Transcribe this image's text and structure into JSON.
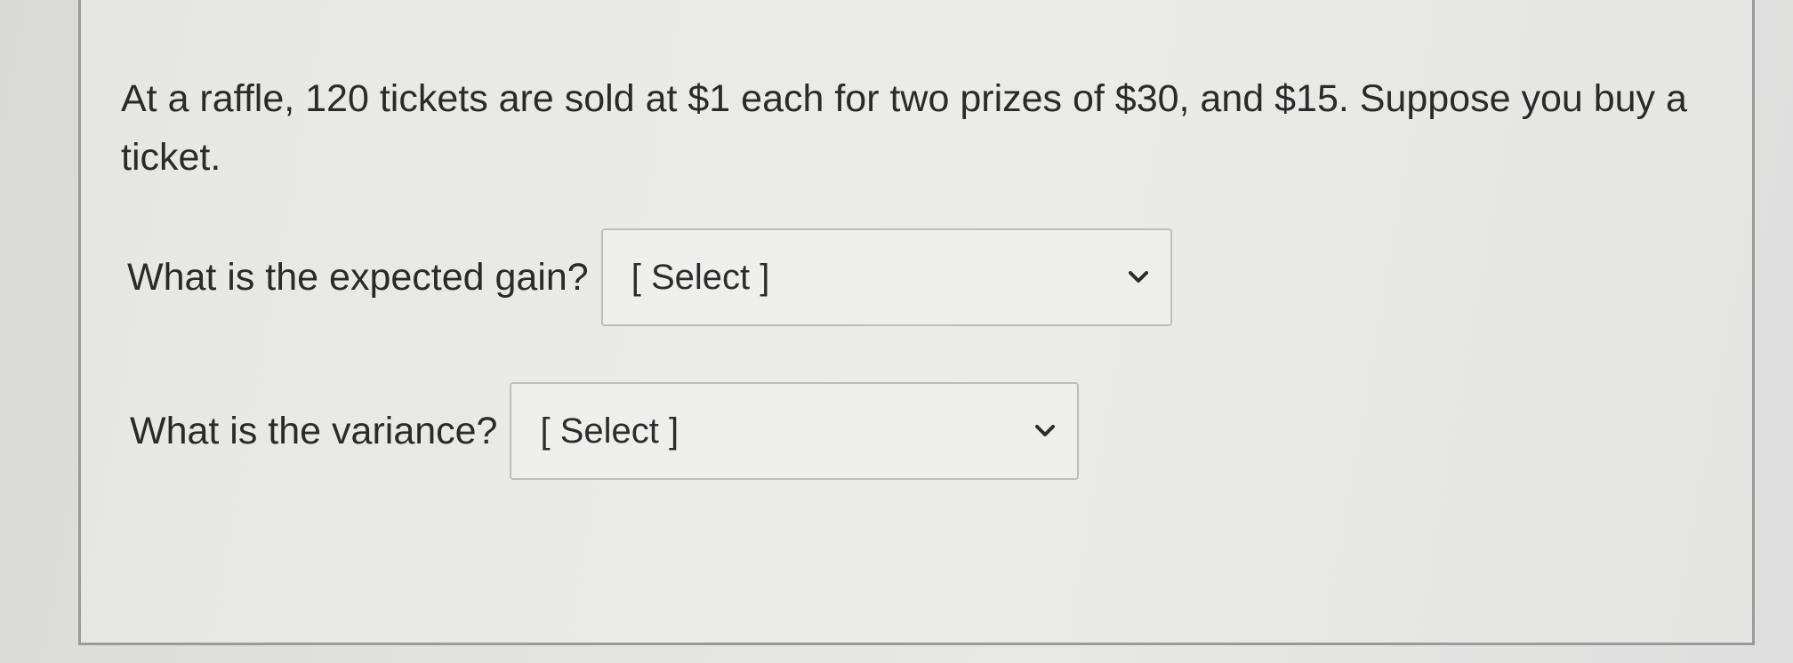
{
  "question": {
    "text": "At a raffle, 120 tickets are sold at $1 each for two prizes of $30, and $15. Suppose you buy a ticket."
  },
  "fields": [
    {
      "label": "What is the expected gain?",
      "selected": "[ Select ]",
      "icon": "chevron-down-icon"
    },
    {
      "label": "What is the variance?",
      "selected": "[ Select ]",
      "icon": "chevron-down-icon"
    }
  ],
  "colors": {
    "text": "#2a2a2a",
    "border": "#9a9a98",
    "select_border": "#bdbdbb"
  }
}
